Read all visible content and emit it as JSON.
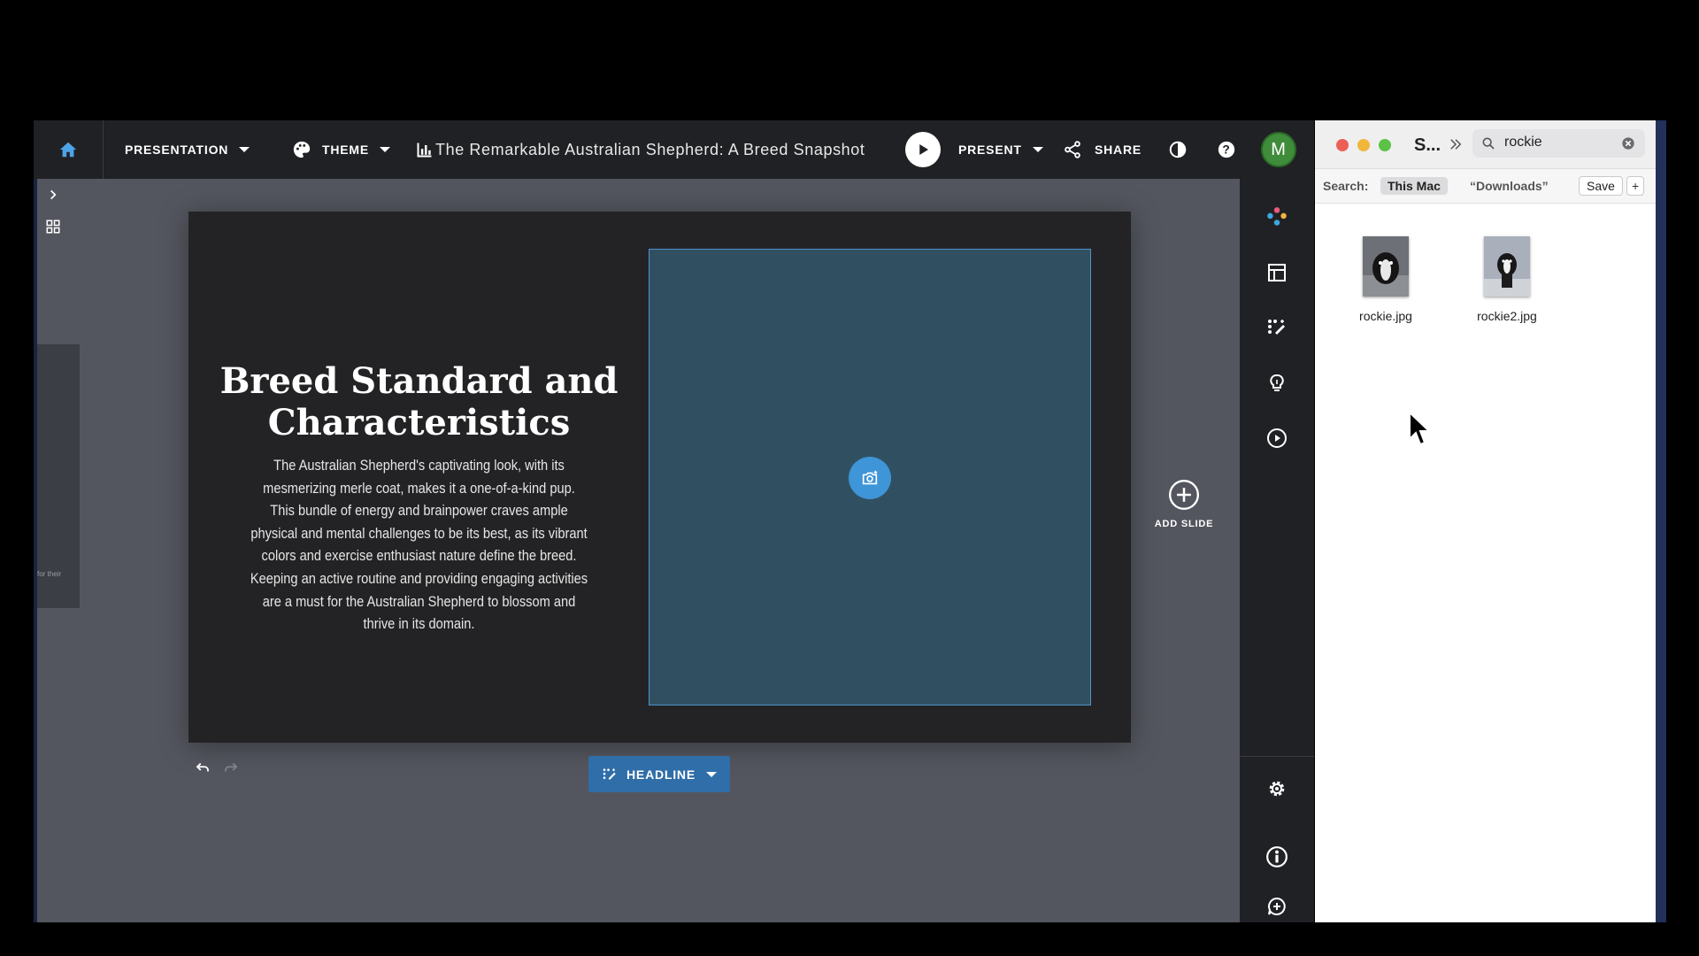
{
  "toolbar": {
    "presentation_label": "PRESENTATION",
    "theme_label": "THEME",
    "title": "The Remarkable Australian Shepherd: A Breed Snapshot",
    "present_label": "PRESENT",
    "share_label": "SHARE",
    "avatar_initial": "M",
    "avatar_color": "#3f8c3a"
  },
  "sidebar": {
    "thumb_text": "for their"
  },
  "slide": {
    "title": "Breed Standard and Characteristics",
    "body": "The Australian Shepherd's captivating look, with its mesmerizing merle coat, makes it a one-of-a-kind pup. This bundle of energy and brainpower craves ample physical and mental challenges to be its best, as its vibrant colors and exercise enthusiast nature define the breed. Keeping an active routine and providing engaging activities are a must for the Australian Shepherd to blossom and thrive in its domain."
  },
  "editor": {
    "headline_label": "HEADLINE",
    "add_slide_label": "ADD SLIDE"
  },
  "finder": {
    "title": "S...",
    "search_value": "rockie",
    "search_label": "Search:",
    "scope_this_mac": "This Mac",
    "scope_downloads": "“Downloads”",
    "save_label": "Save",
    "add_label": "+",
    "files": [
      {
        "name": "rockie.jpg"
      },
      {
        "name": "rockie2.jpg"
      }
    ]
  },
  "colors": {
    "accent": "#3e95d8",
    "headline_bg": "#2f6ea8",
    "slide_bg": "#232325",
    "image_placeholder": "#305062"
  }
}
